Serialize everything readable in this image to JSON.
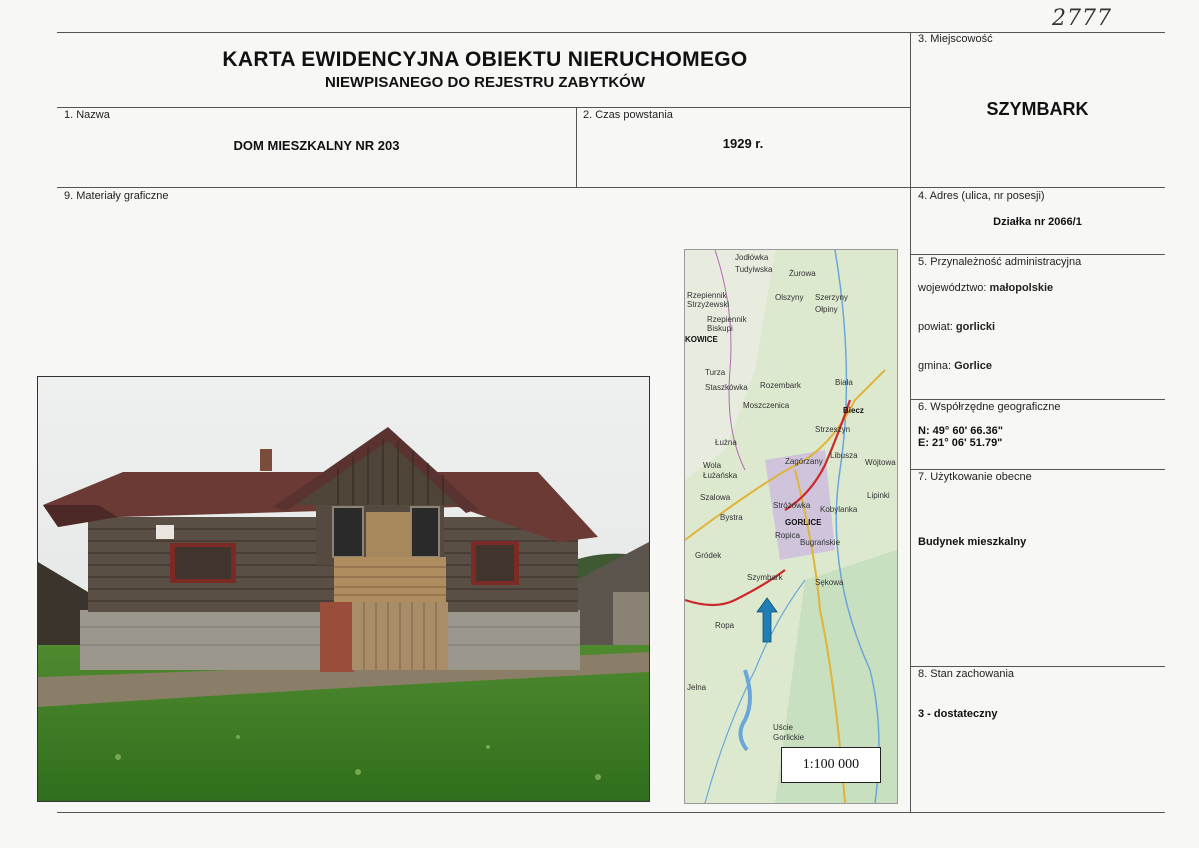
{
  "handwritten_number": "2777",
  "header": {
    "title": "KARTA EWIDENCYJNA OBIEKTU NIERUCHOMEGO",
    "subtitle": "NIEWPISANEGO DO REJESTRU ZABYTKÓW"
  },
  "fields": {
    "name": {
      "label": "1. Nazwa",
      "value": "DOM MIESZKALNY NR 203"
    },
    "period": {
      "label": "2. Czas powstania",
      "value": "1929 r."
    },
    "locality": {
      "label": "3. Miejscowość",
      "value": "SZYMBARK"
    },
    "address": {
      "label": "4. Adres (ulica, nr posesji)",
      "value": "Działka nr 2066/1"
    },
    "admin": {
      "label": "5. Przynależność administracyjna",
      "voivodeship_label": "województwo:",
      "voivodeship": "małopolskie",
      "county_label": "powiat:",
      "county": "gorlicki",
      "commune_label": "gmina:",
      "commune": "Gorlice"
    },
    "coords": {
      "label": "6. Współrzędne geograficzne",
      "n": "N: 49° 60' 66.36\"",
      "e": "E: 21° 06' 51.79\""
    },
    "usage": {
      "label": "7. Użytkowanie obecne",
      "value": "Budynek mieszkalny"
    },
    "condition": {
      "label": "8. Stan zachowania",
      "value": "3 - dostateczny"
    },
    "graphics": {
      "label": "9. Materiały graficzne"
    }
  },
  "map": {
    "scale": "1:100 000",
    "places": [
      "Jodłówka",
      "Tudyiwska",
      "Żurowa",
      "Rzepiennik Strzyżewski",
      "Olszyny",
      "Szerzyny",
      "Ołpiny",
      "Rzepiennik Biskupi",
      "KOWICE",
      "Turza",
      "Staszkówka",
      "Rozembark",
      "Biała",
      "Moszczenica",
      "Biecz",
      "Łużna",
      "Strzeszyn",
      "Libusza",
      "Wójtowa",
      "Wola Łużańska",
      "Zagórzany",
      "Szalowa",
      "Stróżówka",
      "Bystra",
      "GORLICE",
      "Kobylanka",
      "Lipinki",
      "Ropica",
      "Bugrańskie",
      "Gródek",
      "Szymbark",
      "Sękowa",
      "Ropa",
      "Uście Gorlickie",
      "Jelna"
    ]
  },
  "colors": {
    "arrow": "#1f7fb5",
    "road": "#cc2a2a"
  }
}
